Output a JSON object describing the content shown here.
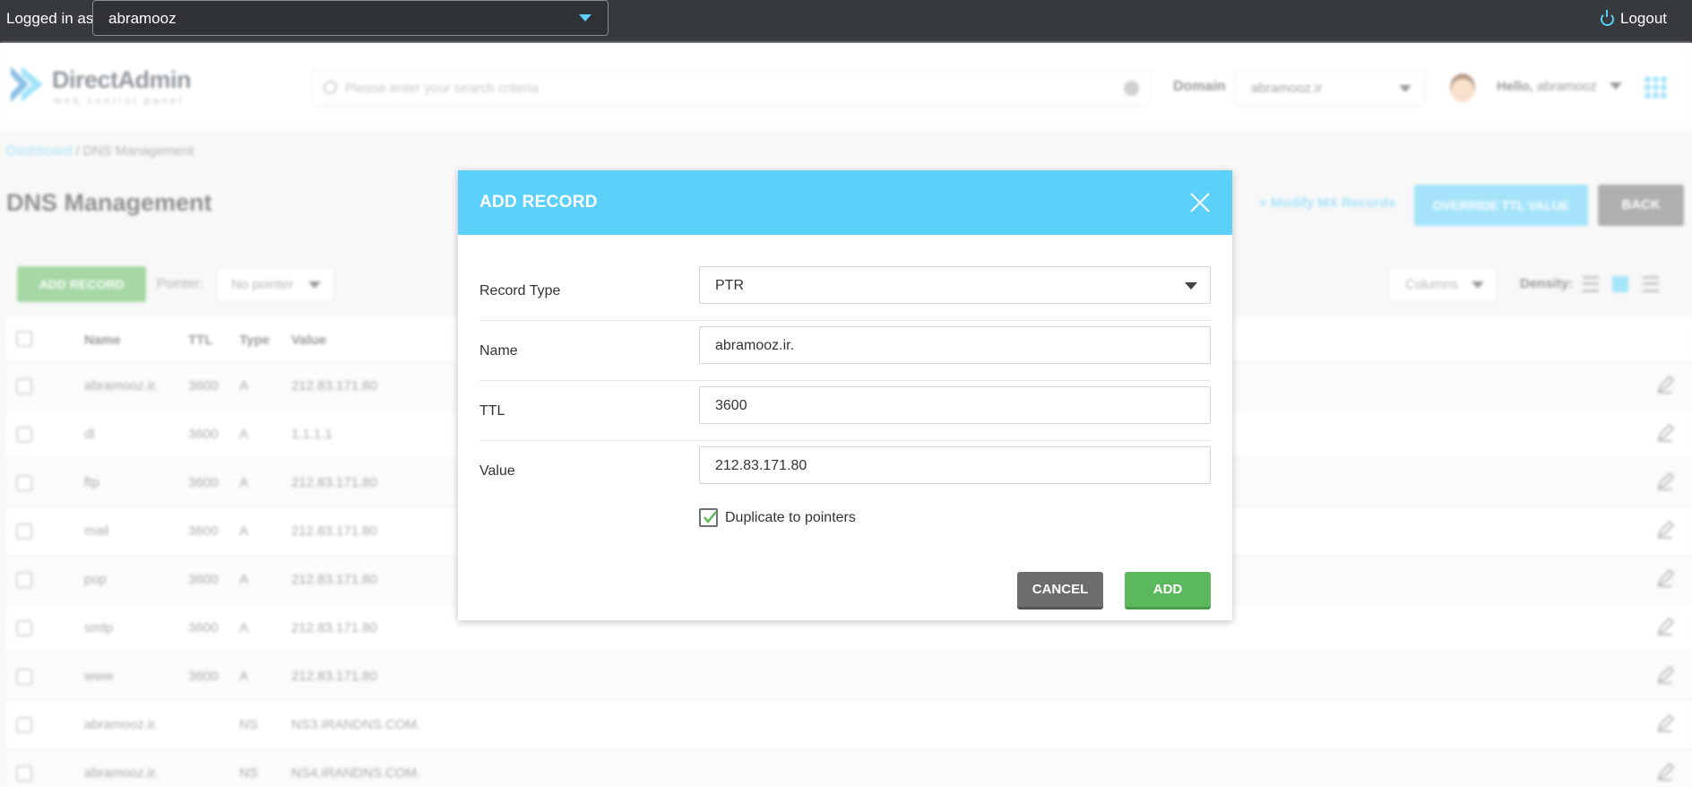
{
  "topbar": {
    "logged_in_as": "Logged in as",
    "user": "abramooz",
    "logout": "Logout"
  },
  "header": {
    "logo_name": "DirectAdmin",
    "logo_sub": "web control panel",
    "search_placeholder": "Please enter your search criteria",
    "domain_label": "Domain",
    "domain_value": "abramooz.ir",
    "hello": "Hello,",
    "hello_user": "abramooz"
  },
  "breadcrumb": {
    "dashboard": "Dashboard",
    "current": " / DNS Management"
  },
  "page": {
    "title": "DNS Management",
    "modify_mx": "+ Modify MX Records",
    "override_ttl": "OVERRIDE TTL VALUE",
    "back": "BACK",
    "add_record": "ADD RECORD",
    "pointer_label": "Pointer:",
    "pointer_value": "No pointer",
    "columns": "Columns",
    "density": "Density:"
  },
  "table": {
    "headers": [
      "Name",
      "TTL",
      "Type",
      "Value"
    ],
    "rows": [
      {
        "name": "abramooz.ir.",
        "ttl": "3600",
        "type": "A",
        "value": "212.83.171.80"
      },
      {
        "name": "dl",
        "ttl": "3600",
        "type": "A",
        "value": "1.1.1.1"
      },
      {
        "name": "ftp",
        "ttl": "3600",
        "type": "A",
        "value": "212.83.171.80"
      },
      {
        "name": "mail",
        "ttl": "3600",
        "type": "A",
        "value": "212.83.171.80"
      },
      {
        "name": "pop",
        "ttl": "3600",
        "type": "A",
        "value": "212.83.171.80"
      },
      {
        "name": "smtp",
        "ttl": "3600",
        "type": "A",
        "value": "212.83.171.80"
      },
      {
        "name": "www",
        "ttl": "3600",
        "type": "A",
        "value": "212.83.171.80"
      },
      {
        "name": "abramooz.ir.",
        "ttl": "",
        "type": "NS",
        "value": "NS3.IRANDNS.COM."
      },
      {
        "name": "abramooz.ir.",
        "ttl": "",
        "type": "NS",
        "value": "NS4.IRANDNS.COM."
      }
    ]
  },
  "modal": {
    "title": "ADD RECORD",
    "record_type_label": "Record Type",
    "record_type_value": "PTR",
    "name_label": "Name",
    "name_value": "abramooz.ir.",
    "ttl_label": "TTL",
    "ttl_value": "3600",
    "value_label": "Value",
    "value_value": "212.83.171.80",
    "duplicate_label": "Duplicate to pointers",
    "duplicate_checked": true,
    "cancel": "CANCEL",
    "add": "ADD"
  },
  "colors": {
    "accent": "#5bd0fb",
    "success": "#5cb85c",
    "topbar": "#373a3d",
    "secondary": "#6d6d6d"
  }
}
